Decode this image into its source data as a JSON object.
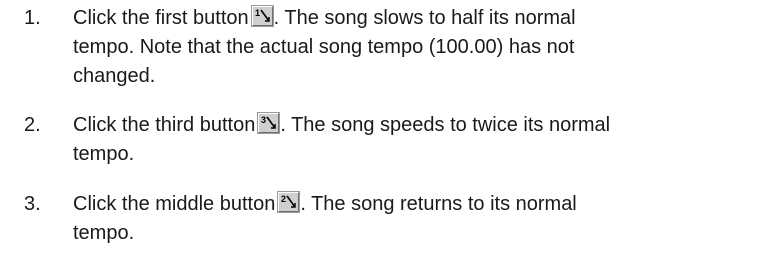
{
  "steps": [
    {
      "number": "1.",
      "text_before": "Click the first button",
      "icon": "tempo-half-icon",
      "icon_digit": "1",
      "line1_after": ". The song slows to half its normal",
      "line2": "tempo. Note that the actual song tempo (100.00) has not",
      "line3": "changed."
    },
    {
      "number": "2.",
      "text_before": "Click the third button",
      "icon": "tempo-double-icon",
      "icon_digit": "3",
      "line1_after": ". The song speeds to twice its normal",
      "line2": "tempo."
    },
    {
      "number": "3.",
      "text_before": "Click the middle button",
      "icon": "tempo-normal-icon",
      "icon_digit": "2",
      "line1_after": ". The song returns to its normal",
      "line2": "tempo."
    }
  ]
}
